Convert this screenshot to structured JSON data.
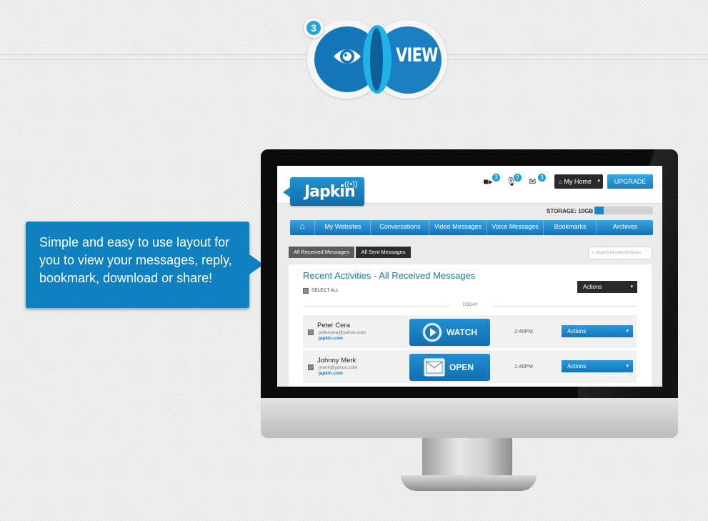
{
  "step": {
    "number": "3",
    "label": "VIEW",
    "icon": "eye-icon",
    "accent": "#0f80c0",
    "accent_light": "#27a5d9"
  },
  "callout": {
    "text": "Simple and easy to use layout for you to view your messages, reply, bookmark, download or share!"
  },
  "app": {
    "logo": "Japkin",
    "header": {
      "video_count": "3",
      "voice_count": "2",
      "mail_count": "3",
      "home_label": "My Home",
      "upgrade_label": "UPGRADE"
    },
    "storage": {
      "label": "STORAGE: 10GB",
      "fraction": 0.16
    },
    "nav": [
      "My Websites",
      "Conversations",
      "Video Messages",
      "Voice Messages",
      "Bookmarks",
      "Archives"
    ],
    "tabs": {
      "received": "All Received Messages",
      "sent": "All Sent Messages"
    },
    "search": {
      "placeholder": "Search Recent Activities"
    },
    "panel": {
      "title": "Recent Activities - All Received Messages",
      "select_all": "SELECT ALL",
      "actions_label": "Actions",
      "day_label": "TODAY"
    },
    "messages": [
      {
        "name": "Peter Cera",
        "email": "petercera@yahoo.com",
        "link": "japkin.com",
        "button": "WATCH",
        "time": "2:40PM",
        "actions": "Actions"
      },
      {
        "name": "Johnny Merk",
        "email": "jmerk@yahoo.com",
        "link": "japkin.com",
        "button": "OPEN",
        "time": "1:40PM",
        "actions": "Actions"
      }
    ]
  }
}
